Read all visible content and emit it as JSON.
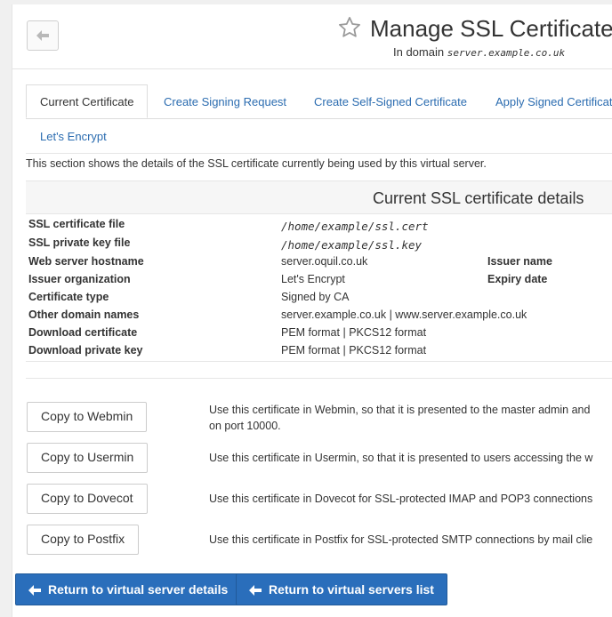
{
  "header": {
    "title": "Manage SSL Certificate",
    "subtitle_prefix": "In domain",
    "domain": "server.example.co.uk"
  },
  "tabs": [
    {
      "label": "Current Certificate",
      "active": true
    },
    {
      "label": "Create Signing Request",
      "active": false
    },
    {
      "label": "Create Self-Signed Certificate",
      "active": false
    },
    {
      "label": "Apply Signed Certificate",
      "active": false
    },
    {
      "label": "Let's Encrypt",
      "active": false
    }
  ],
  "description": "This section shows the details of the SSL certificate currently being used by this virtual server.",
  "details": {
    "title": "Current SSL certificate details",
    "cert_file_label": "SSL certificate file",
    "cert_file": "/home/example/ssl.cert",
    "key_file_label": "SSL private key file",
    "key_file": "/home/example/ssl.key",
    "hostname_label": "Web server hostname",
    "hostname": "server.oquil.co.uk",
    "issuer_name_label": "Issuer name",
    "issuer_org_label": "Issuer organization",
    "issuer_org": "Let's Encrypt",
    "expiry_label": "Expiry date",
    "cert_type_label": "Certificate type",
    "cert_type": "Signed by CA",
    "other_domains_label": "Other domain names",
    "other_domains": "server.example.co.uk | www.server.example.co.uk",
    "download_cert_label": "Download certificate",
    "download_key_label": "Download private key",
    "pem_format": "PEM format",
    "separator": " | ",
    "pkcs12_format": "PKCS12 format"
  },
  "copy_actions": [
    {
      "button": "Copy to Webmin",
      "desc_line1": "Use this certificate in Webmin, so that it is presented to the master admin and",
      "desc_line2": "on port 10000."
    },
    {
      "button": "Copy to Usermin",
      "desc_line1": "Use this certificate in Usermin, so that it is presented to users accessing the w"
    },
    {
      "button": "Copy to Dovecot",
      "desc_line1": "Use this certificate in Dovecot for SSL-protected IMAP and POP3 connections"
    },
    {
      "button": "Copy to Postfix",
      "desc_line1": "Use this certificate in Postfix for SSL-protected SMTP connections by mail clie"
    }
  ],
  "footer": {
    "return_details": "Return to virtual server details",
    "return_list": "Return to virtual servers list"
  },
  "colors": {
    "accent": "#2a6ebb",
    "link": "#2b6cb0",
    "background_strip": "#f0f0f0"
  },
  "icons": {
    "back": "arrow-left-icon",
    "favorite": "star-outline-icon",
    "return": "arrow-left-icon"
  }
}
